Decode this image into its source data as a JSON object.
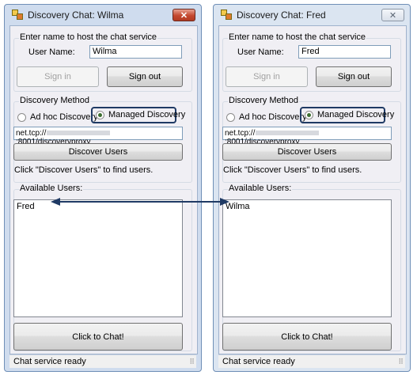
{
  "windows": [
    {
      "title": "Discovery Chat: Wilma",
      "host_group_label": "Enter name to host the chat service",
      "user_name_label": "User Name:",
      "user_name_value": "Wilma",
      "sign_in_label": "Sign in",
      "sign_out_label": "Sign out",
      "discovery_method_label": "Discovery Method",
      "adhoc_label": "Ad hoc Discovery",
      "managed_label": "Managed Discovery",
      "proxy_prefix": "net.tcp://",
      "proxy_suffix": ":8001/discoveryproxy",
      "discover_button_label": "Discover Users",
      "hint_text": "Click \"Discover Users\" to find users.",
      "available_users_label": "Available Users:",
      "users": [
        "Fred"
      ],
      "chat_button_label": "Click to Chat!",
      "status_text": "Chat service ready",
      "close_glyph": "✕"
    },
    {
      "title": "Discovery Chat: Fred",
      "host_group_label": "Enter name to host the chat service",
      "user_name_label": "User Name:",
      "user_name_value": "Fred",
      "sign_in_label": "Sign in",
      "sign_out_label": "Sign out",
      "discovery_method_label": "Discovery Method",
      "adhoc_label": "Ad hoc Discovery",
      "managed_label": "Managed Discovery",
      "proxy_prefix": "net.tcp://",
      "proxy_suffix": ":8001/discoveryproxy",
      "discover_button_label": "Discover Users",
      "hint_text": "Click \"Discover Users\" to find users.",
      "available_users_label": "Available Users:",
      "users": [
        "Wilma"
      ],
      "chat_button_label": "Click to Chat!",
      "status_text": "Chat service ready",
      "close_glyph": "✕"
    }
  ],
  "colors": {
    "highlight_box": "#1f3a64",
    "arrow": "#1f3a64",
    "active_close": "#c4482f"
  },
  "icons": {
    "app": "app-windows-icon",
    "grip": "resize-grip-icon",
    "arrow": "double-arrow-icon"
  }
}
